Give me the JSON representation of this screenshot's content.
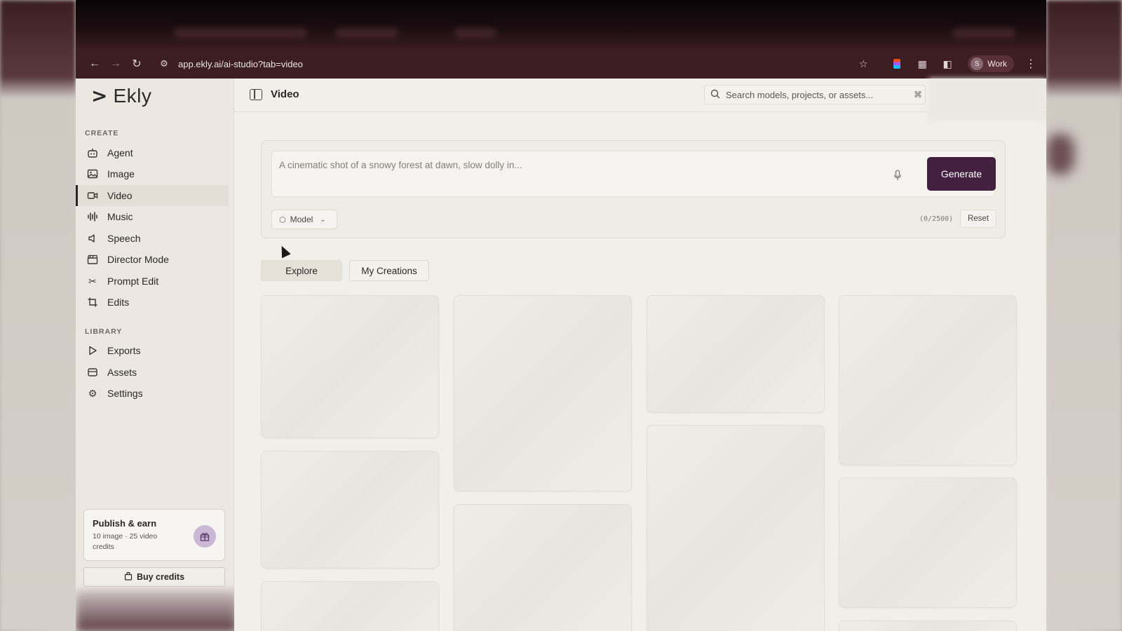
{
  "browser": {
    "url": "app.ekly.ai/ai-studio?tab=video",
    "profile_initial": "S",
    "profile_name": "Work"
  },
  "app": {
    "logo_mark": ">",
    "logo_text": "Ekly",
    "brand_color": "#43203f"
  },
  "sidebar": {
    "create_label": "CREATE",
    "create_items": [
      {
        "label": "Agent",
        "icon": "robot-icon"
      },
      {
        "label": "Image",
        "icon": "image-icon"
      },
      {
        "label": "Video",
        "icon": "video-camera-icon",
        "active": true
      },
      {
        "label": "Music",
        "icon": "waveform-icon"
      },
      {
        "label": "Speech",
        "icon": "speaker-icon"
      },
      {
        "label": "Director Mode",
        "icon": "clapperboard-icon"
      },
      {
        "label": "Prompt Edit",
        "icon": "scissors-icon"
      },
      {
        "label": "Edits",
        "icon": "crop-icon"
      }
    ],
    "library_label": "LIBRARY",
    "library_items": [
      {
        "label": "Exports",
        "icon": "play-icon"
      },
      {
        "label": "Assets",
        "icon": "archive-icon"
      },
      {
        "label": "Settings",
        "icon": "gear-icon"
      }
    ],
    "promo": {
      "title": "Publish & earn",
      "subtitle": "10 image · 25 video credits",
      "icon": "gift-icon"
    },
    "buy_credits": "Buy credits"
  },
  "main": {
    "page_title": "Video",
    "search_placeholder": "Search models, projects, or assets...",
    "search_shortcut": "⌘",
    "composer": {
      "prompt_placeholder": "A cinematic shot of a snowy forest at dawn, slow dolly in...",
      "generate_label": "Generate",
      "model_label": "Model",
      "counter": "(0/2500)",
      "reset_label": "Reset"
    },
    "tabs": [
      {
        "label": "Explore",
        "active": true
      },
      {
        "label": "My Creations",
        "active": false
      }
    ]
  }
}
